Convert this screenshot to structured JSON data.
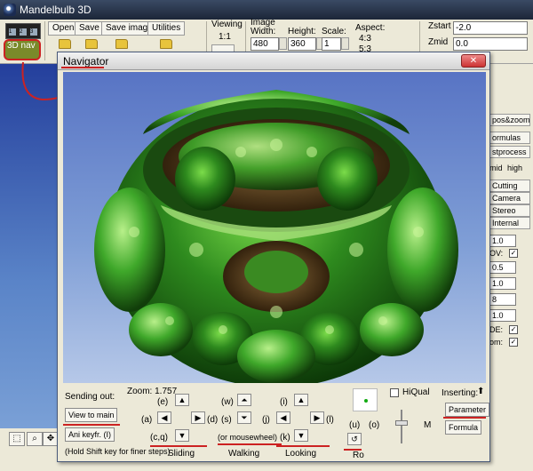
{
  "window": {
    "title": "Mandelbulb 3D"
  },
  "toolbar": {
    "film_frames": [
      "1",
      "2",
      "3"
    ],
    "nav_button_label": "3D nav",
    "menu": {
      "open": "Open",
      "save": "Save",
      "save_image": "Save image",
      "utilities": "Utilities"
    },
    "viewing": {
      "label": "Viewing",
      "value": "1:1"
    },
    "image": {
      "label": "Image",
      "width_label": "Width:",
      "width_value": "480",
      "height_label": "Height:",
      "height_value": "360",
      "scale_label": "Scale:",
      "scale_value": "1"
    },
    "aspect": {
      "label": "Aspect:",
      "value1": "4:3",
      "value2": "5:3"
    },
    "zstart": {
      "label": "Zstart",
      "value": "-2.0"
    },
    "zmid": {
      "label": "Zmid",
      "value": "0.0"
    }
  },
  "right_panel": {
    "buttons": [
      "pos&zoom",
      "ormulas",
      "stprocess"
    ],
    "lod_labels": [
      "mid",
      "high"
    ],
    "tabs": [
      "Cutting",
      "Camera",
      "Stereo",
      "Internal"
    ],
    "fields": [
      "1.0",
      "0.5",
      "1.0",
      "8",
      "1.0"
    ],
    "fov_label": "OV:",
    "de_label": "DE:",
    "zoom_label": "om:"
  },
  "navigator": {
    "title": "Navigator",
    "sending_out": "Sending out:",
    "zoom": "Zoom: 1.757",
    "view_to_main": "View to main",
    "ani_keyfr": "Ani keyfr. (I)",
    "hint": "(Hold Shift key for finer steps)",
    "sliding": {
      "label": "Sliding",
      "keys": [
        "(e)",
        "(a)",
        "(d)",
        "(c,q)"
      ]
    },
    "walking": {
      "label": "Walking",
      "keys": [
        "(w)",
        "(s)",
        "(or mousewheel)"
      ]
    },
    "looking": {
      "label": "Looking",
      "keys": [
        "(i)",
        "(j)",
        "(l)",
        "(k)"
      ]
    },
    "roll": {
      "keys": [
        "(u)",
        "(o)"
      ],
      "label": "Ro"
    },
    "hiqual": "HiQual",
    "m_label": "M",
    "inserting": "Inserting:",
    "parameter": "Parameter",
    "formula": "Formula"
  }
}
